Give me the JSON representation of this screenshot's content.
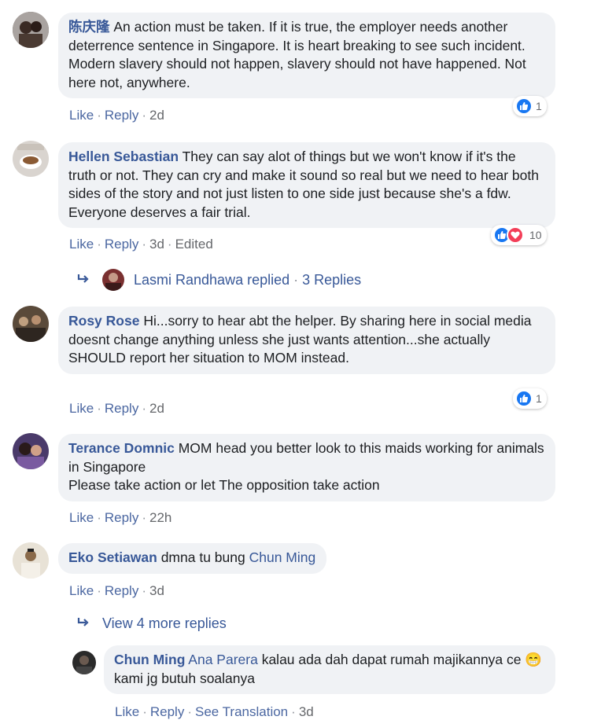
{
  "colors": {
    "link": "#385898",
    "bubble": "#f0f2f5",
    "meta": "#65676b",
    "like_blue": "#1877f2",
    "love_red": "#f33e58"
  },
  "comments": [
    {
      "author": "陈庆隆",
      "text": "An action must be taken. If it is true, the employer needs another deterrence sentence in Singapore. It is heart breaking to see such incident. Modern slavery should not happen, slavery should not have happened. Not here not, anywhere.",
      "like": "Like",
      "reply": "Reply",
      "time": "2d",
      "reaction_count": "1",
      "reaction_icons": [
        "like-icon"
      ]
    },
    {
      "author": "Hellen Sebastian",
      "text": "They can say alot of things but we won't know if it's the truth or not. They can cry and make it sound so real but we need to hear both sides of the story and not just listen to one side just because she's a fdw. Everyone deserves a fair trial.",
      "like": "Like",
      "reply": "Reply",
      "time": "3d",
      "edited": "Edited",
      "reaction_count": "10",
      "reaction_icons": [
        "like-icon",
        "love-icon"
      ],
      "replied": {
        "name": "Lasmi Randhawa replied",
        "dot": "·",
        "count": "3 Replies"
      }
    },
    {
      "author": "Rosy Rose",
      "text": "Hi...sorry to hear abt the helper. By sharing here in social media doesnt change anything unless she just wants attention...she actually SHOULD report her situation to MOM instead.",
      "like": "Like",
      "reply": "Reply",
      "time": "2d",
      "reaction_count": "1",
      "reaction_icons": [
        "like-icon"
      ]
    },
    {
      "author": "Terance Domnic",
      "text_line1": "MOM head you better look to this maids working for animals in Singapore",
      "text_line2": "Please take action or let The opposition take action",
      "like": "Like",
      "reply": "Reply",
      "time": "22h"
    },
    {
      "author": "Eko Setiawan",
      "text": "dmna tu bung",
      "mention": "Chun Ming",
      "like": "Like",
      "reply": "Reply",
      "time": "3d",
      "view_more": "View 4 more replies"
    }
  ],
  "nested_reply": {
    "author": "Chun Ming",
    "mention": "Ana Parera",
    "text_a": "kalau ada dah dapat rumah majikannya ce",
    "emoji": "😁",
    "text_b": "kami jg butuh soalanya",
    "like": "Like",
    "reply": "Reply",
    "see_translation": "See Translation",
    "time": "3d"
  },
  "separator": "·"
}
